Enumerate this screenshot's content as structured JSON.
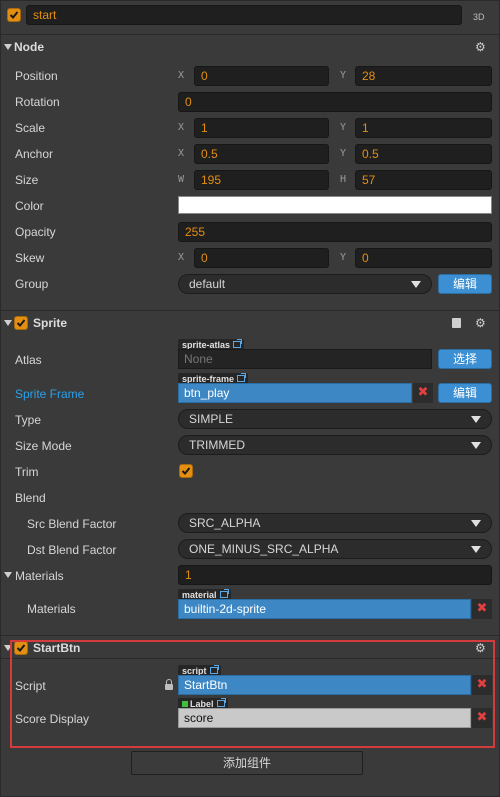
{
  "header": {
    "name_value": "start",
    "mode_3d": "3D"
  },
  "node": {
    "title": "Node",
    "position": {
      "label": "Position",
      "x_axis": "X",
      "x": "0",
      "y_axis": "Y",
      "y": "28"
    },
    "rotation": {
      "label": "Rotation",
      "value": "0"
    },
    "scale": {
      "label": "Scale",
      "x_axis": "X",
      "x": "1",
      "y_axis": "Y",
      "y": "1"
    },
    "anchor": {
      "label": "Anchor",
      "x_axis": "X",
      "x": "0.5",
      "y_axis": "Y",
      "y": "0.5"
    },
    "size": {
      "label": "Size",
      "w_axis": "W",
      "w": "195",
      "h_axis": "H",
      "h": "57"
    },
    "color": {
      "label": "Color",
      "value": "#ffffff"
    },
    "opacity": {
      "label": "Opacity",
      "value": "255"
    },
    "skew": {
      "label": "Skew",
      "x_axis": "X",
      "x": "0",
      "y_axis": "Y",
      "y": "0"
    },
    "group": {
      "label": "Group",
      "value": "default",
      "edit_button": "编辑"
    }
  },
  "sprite": {
    "title": "Sprite",
    "atlas": {
      "label": "Atlas",
      "tag": "sprite-atlas",
      "value": "None",
      "button": "选择"
    },
    "sprite_frame": {
      "label": "Sprite Frame",
      "tag": "sprite-frame",
      "value": "btn_play",
      "button": "编辑",
      "remove": "✖"
    },
    "type": {
      "label": "Type",
      "value": "SIMPLE"
    },
    "size_mode": {
      "label": "Size Mode",
      "value": "TRIMMED"
    },
    "trim": {
      "label": "Trim",
      "checked": true
    },
    "blend": {
      "label": "Blend"
    },
    "src_blend": {
      "label": "Src Blend Factor",
      "value": "SRC_ALPHA"
    },
    "dst_blend": {
      "label": "Dst Blend Factor",
      "value": "ONE_MINUS_SRC_ALPHA"
    },
    "materials": {
      "label": "Materials",
      "count": "1",
      "item_label": "Materials",
      "tag": "material",
      "value": "builtin-2d-sprite",
      "remove": "✖"
    }
  },
  "start_btn": {
    "title": "StartBtn",
    "script": {
      "label": "Script",
      "tag": "script",
      "value": "StartBtn",
      "remove": "✖"
    },
    "score_display": {
      "label": "Score Display",
      "tag": "Label",
      "value": "score",
      "remove": "✖"
    }
  },
  "add_component": "添加组件",
  "colors": {
    "accent": "#e38f12",
    "link_blue": "#2aa0ea",
    "button_blue": "#3b8fd2",
    "highlight_red": "#d43c3c"
  },
  "icons": [
    "checkbox-icon",
    "gear-icon",
    "collapse-triangle-icon",
    "book-icon",
    "lock-icon",
    "external-link-icon",
    "close-icon",
    "dropdown-caret-icon"
  ]
}
